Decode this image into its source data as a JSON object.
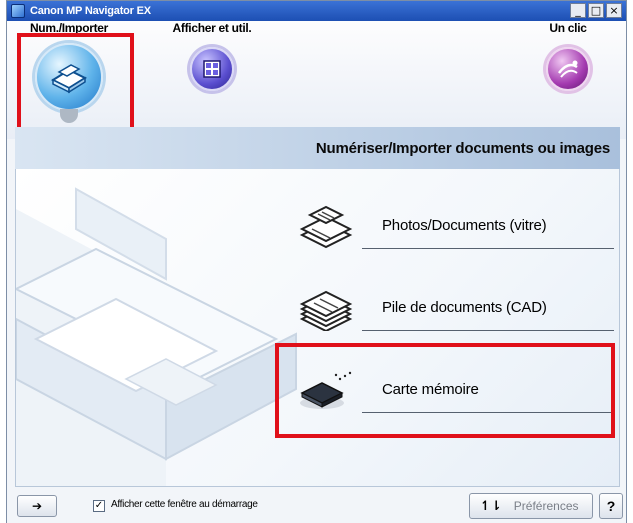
{
  "window": {
    "title": "Canon MP Navigator EX",
    "controls": {
      "minimize": "_",
      "maximize": "□",
      "close": "×"
    }
  },
  "modes": [
    {
      "label": "Num./Importer",
      "icon": "scanner-icon",
      "selected": true
    },
    {
      "label": "Afficher et util.",
      "icon": "gallery-icon",
      "selected": false
    },
    {
      "label": "Un clic",
      "icon": "one-click-icon",
      "selected": false
    }
  ],
  "section": {
    "title": "Numériser/Importer documents ou images"
  },
  "options": [
    {
      "label": "Photos/Documents (vitre)",
      "icon": "platen-documents-icon"
    },
    {
      "label": "Pile de documents (CAD)",
      "icon": "adf-documents-icon"
    },
    {
      "label": "Carte mémoire",
      "icon": "memory-card-icon",
      "highlighted": true
    }
  ],
  "footer": {
    "arrow_icon": "jump-arrow-icon",
    "arrow_glyph": "➔",
    "checkbox_label": "Afficher cette fenêtre au démarrage",
    "checkbox_checked": true,
    "checkbox_glyph": "✓",
    "preferences_icon_glyph": "↿⇂",
    "preferences_label": "Préférences",
    "help_label": "?"
  },
  "colors": {
    "highlight_red": "#e0101a",
    "titlebar_blue": "#1d4fb3"
  }
}
